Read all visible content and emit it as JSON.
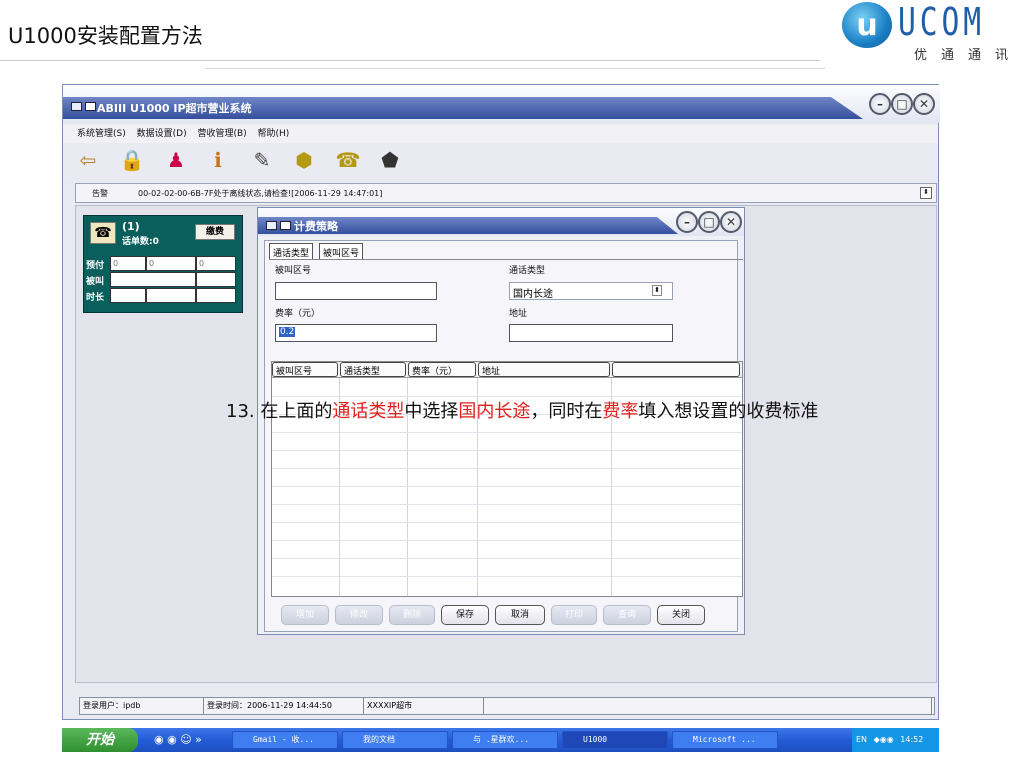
{
  "slide": {
    "title": "U1000安装配置方法"
  },
  "logo": {
    "mark": "u",
    "text": "UCOM",
    "sub": "优通通讯"
  },
  "window": {
    "title": "ABIII U1000 IP超市营业系统",
    "menu": [
      "系统管理(S)",
      "数据设置(D)",
      "营收管理(B)",
      "帮助(H)"
    ],
    "toolbar_icons": [
      "exit-icon",
      "lock-icon",
      "users-icon",
      "info-icon",
      "tools-icon",
      "eia-icon",
      "phone-icon",
      "box-icon"
    ],
    "alert": {
      "label": "告警",
      "text": "00-02-02-00-6B-7F处于离线状态,请检查![2006-11-29 14:47:01]"
    }
  },
  "booth": {
    "line": "(1)",
    "count": "话单数:0",
    "pay_button": "缴费",
    "rows": [
      {
        "label": "预付",
        "cells": [
          "0",
          "0",
          "0"
        ]
      },
      {
        "label": "被叫",
        "cells": [
          "",
          "",
          ""
        ]
      },
      {
        "label": "时长",
        "cells": [
          "",
          "",
          ""
        ]
      }
    ]
  },
  "dialog": {
    "title": "计费策略",
    "tabs": [
      "通话类型",
      "被叫区号"
    ],
    "fields": {
      "called_area_label": "被叫区号",
      "called_area_value": "",
      "call_type_label": "通话类型",
      "call_type_value": "国内长途",
      "rate_label": "费率（元）",
      "rate_value": "0.2",
      "address_label": "地址",
      "address_value": ""
    },
    "columns": [
      "被叫区号",
      "通话类型",
      "费率（元）",
      "地址",
      ""
    ],
    "buttons": [
      {
        "label": "增加",
        "enabled": false
      },
      {
        "label": "修改",
        "enabled": false
      },
      {
        "label": "删除",
        "enabled": false
      },
      {
        "label": "保存",
        "enabled": true
      },
      {
        "label": "取消",
        "enabled": true
      },
      {
        "label": "打印",
        "enabled": false
      },
      {
        "label": "查询",
        "enabled": false
      },
      {
        "label": "关闭",
        "enabled": true
      }
    ]
  },
  "annotation": {
    "p1": "13. 在上面的",
    "r1": "通话类型",
    "p2": "中选择",
    "r2": "国内长途",
    "p3": "，同时在",
    "r3": "费率",
    "p4": "填入想设置的收费标准"
  },
  "status": {
    "user": "登录用户：ipdb",
    "time": "登录时间：2006-11-29 14:44:50",
    "store": "XXXXIP超市"
  },
  "taskbar": {
    "start": "开始",
    "items": [
      "Gmail - 收...",
      "我的文档",
      "与 .星群欢...",
      "U1000",
      "Microsoft ..."
    ],
    "tray_lang": "EN",
    "clock": "14:52"
  },
  "colors": {
    "accent_red": "#e0201c",
    "titlebar_blue": "#344f9c",
    "booth_green": "#0a5f5c",
    "taskbar_blue": "#245cd6"
  }
}
